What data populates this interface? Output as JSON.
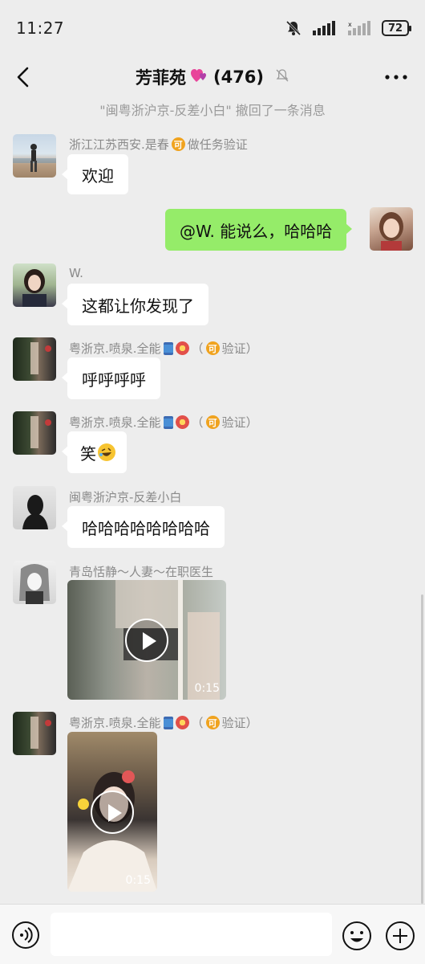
{
  "status_bar": {
    "time": "11:27",
    "battery": "72"
  },
  "header": {
    "title": "芳菲苑",
    "count": "(476)"
  },
  "system_notice": "\"闽粤浙沪京-反差小白\" 撤回了一条消息",
  "messages": [
    {
      "sender_a": "浙江江苏西安.是春",
      "sender_b": "做任务验证",
      "text": "欢迎"
    },
    {
      "text": "@W. 能说么，哈哈哈"
    },
    {
      "sender": "W.",
      "text": "这都让你发现了"
    },
    {
      "sender": "粤浙京.喷泉.全能",
      "sender_b": "（",
      "sender_c": "验证）",
      "text": "呼呼呼呼"
    },
    {
      "sender": "粤浙京.喷泉.全能",
      "sender_b": "（",
      "sender_c": "验证）",
      "text": "笑"
    },
    {
      "sender": "闽粤浙沪京-反差小白",
      "text": "哈哈哈哈哈哈哈哈"
    },
    {
      "sender": "青岛恬静～人妻～在职医生",
      "duration": "0:15"
    },
    {
      "sender": "粤浙京.喷泉.全能",
      "sender_b": "（",
      "sender_c": "验证）",
      "duration": "0:15"
    }
  ],
  "coin_glyph": "可",
  "colors": {
    "background": "#ededed",
    "bubble_self": "#95ec69",
    "bubble_other": "#ffffff",
    "coin": "#f0a31f"
  },
  "icons": [
    "back-icon",
    "hearts-icon",
    "bell-off-icon",
    "more-icon",
    "play-icon",
    "voice-icon",
    "emoji-icon",
    "plus-icon"
  ]
}
